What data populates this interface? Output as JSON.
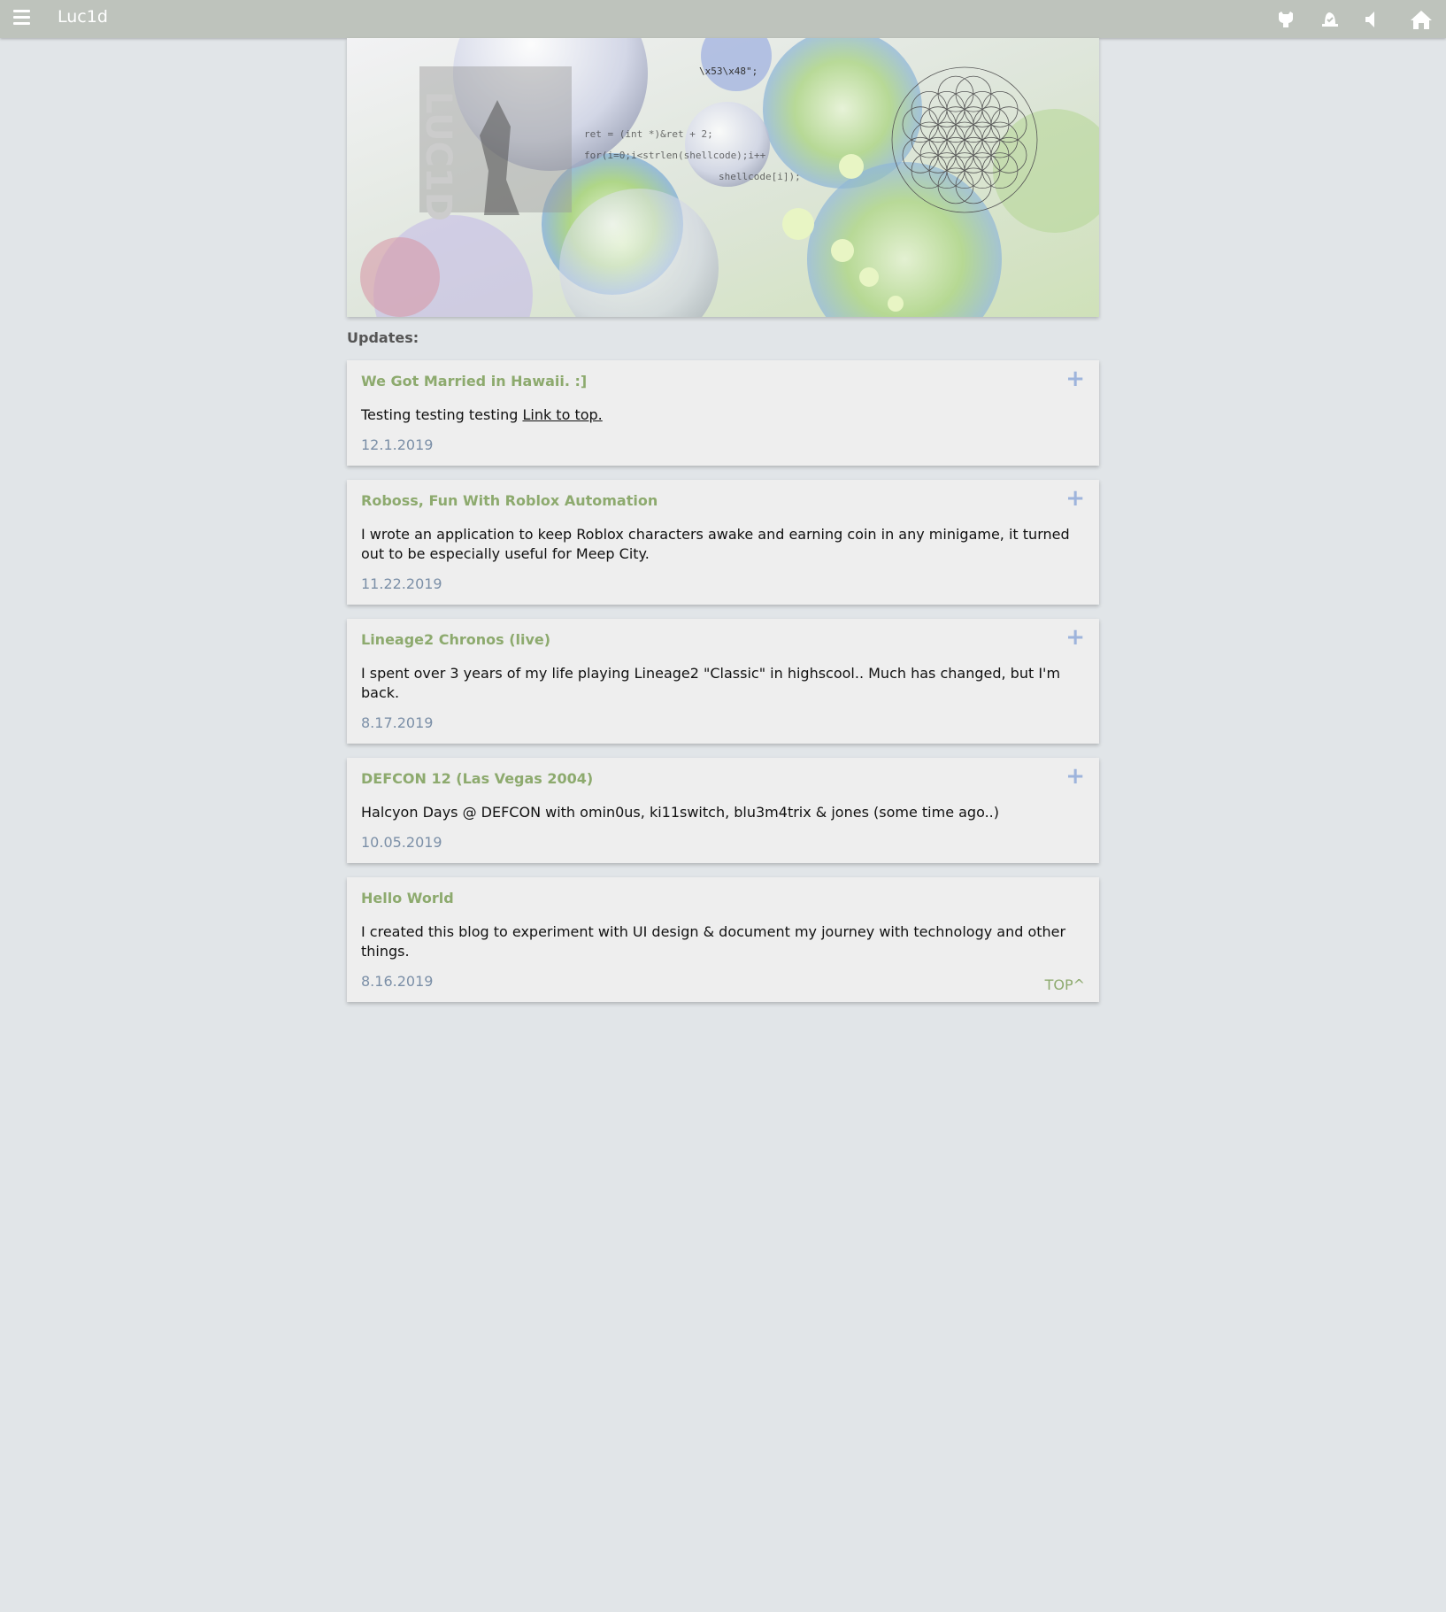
{
  "header": {
    "title": "Luc1d",
    "icons": [
      "menu-icon",
      "github-icon",
      "hat-icon",
      "speaker-icon",
      "home-icon"
    ]
  },
  "banner": {
    "logo_text": "LUC1D",
    "code_lines": [
      "\\x53\\x48\";",
      "ret = (int *)&ret + 2;",
      "for(i=0;i<strlen(shellcode);i++",
      "shellcode[i]);"
    ]
  },
  "updates_label": "Updates:",
  "posts": [
    {
      "title": "We Got Married in Hawaii. :]",
      "body": "Testing testing testing ",
      "link": "Link to top.",
      "date": "12.1.2019",
      "expand": "+"
    },
    {
      "title": "Roboss, Fun With Roblox Automation",
      "body": "I wrote an application to keep Roblox characters awake and earning coin in any minigame, it turned out to be especially useful for Meep City.",
      "date": "11.22.2019",
      "expand": "+"
    },
    {
      "title": "Lineage2 Chronos (live)",
      "body": "I spent over 3 years of my life playing Lineage2 \"Classic\" in highscool.. Much has changed, but I'm back.",
      "date": "8.17.2019",
      "expand": "+"
    },
    {
      "title": "DEFCON 12 (Las Vegas 2004)",
      "body": "Halcyon Days @ DEFCON with omin0us, ki11switch, blu3m4trix & jones (some time ago..)",
      "date": "10.05.2019",
      "expand": "+"
    },
    {
      "title": "Hello World",
      "body": "I created this blog to experiment with UI design & document my journey with technology and other things.",
      "date": "8.16.2019",
      "top_link": "TOP^"
    }
  ],
  "colors": {
    "topbar": "#bec3bc",
    "background": "#e1e5e8",
    "card": "#eeeeee",
    "title_green": "#8daa6e",
    "date_blue": "#7b8fa7",
    "plus_blue": "#9eb4dc"
  }
}
